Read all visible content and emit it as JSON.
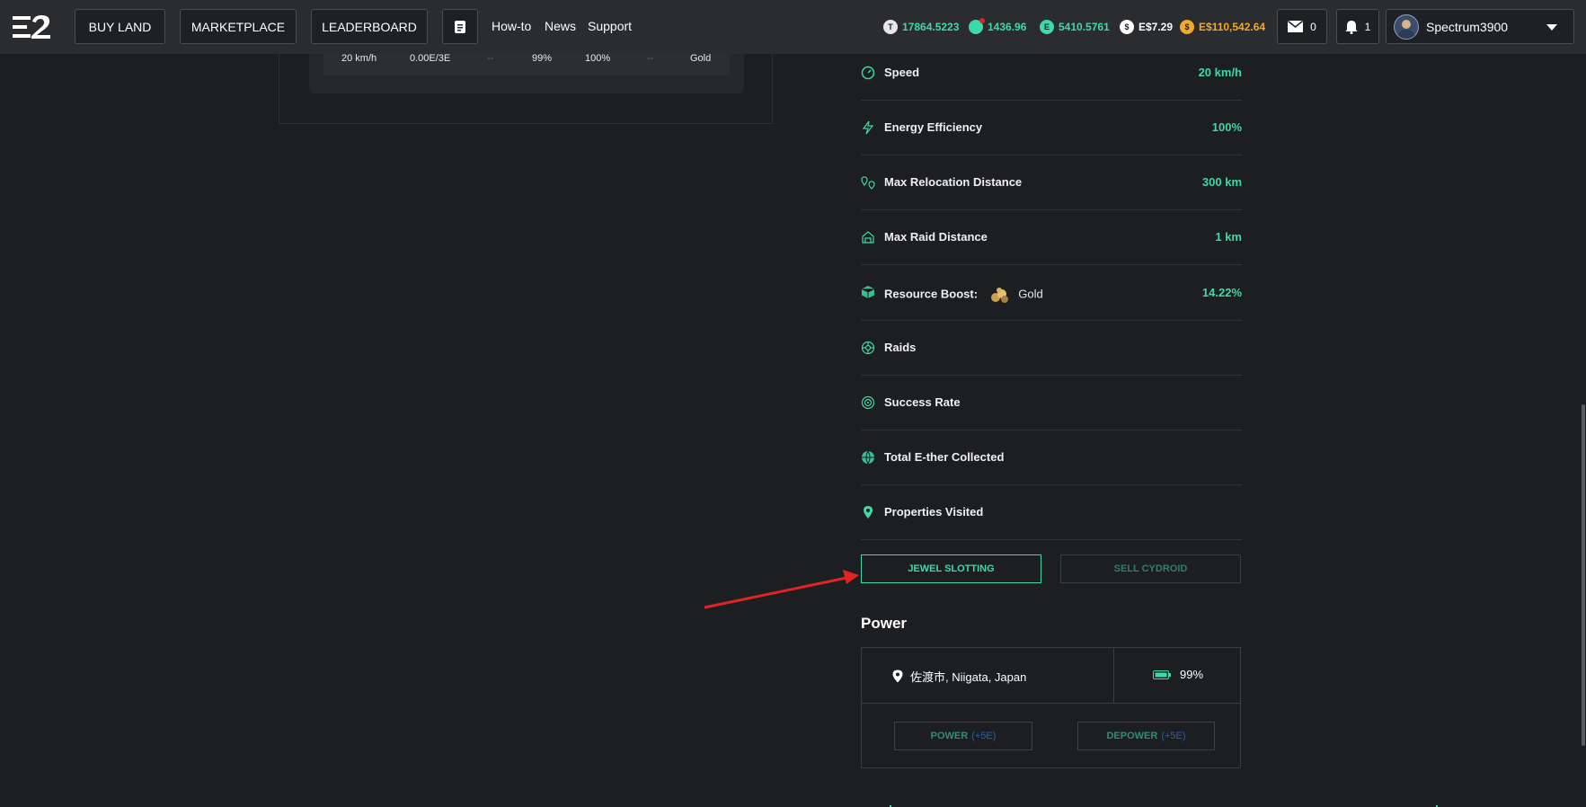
{
  "nav": {
    "buy_land": "BUY LAND",
    "marketplace": "MARKETPLACE",
    "leaderboard": "LEADERBOARD",
    "howto": "How-to",
    "news": "News",
    "support": "Support"
  },
  "balances": [
    {
      "icon": "tile-icon",
      "value": "17864.5223",
      "color": "#3dd9a8"
    },
    {
      "icon": "essence-icon",
      "value": "1436.96",
      "color": "#3dd9a8"
    },
    {
      "icon": "ether-icon",
      "value": "5410.5761",
      "color": "#3dd9a8"
    },
    {
      "icon": "dollar-icon",
      "value": "E$7.29",
      "color": "#ffffff"
    },
    {
      "icon": "gold-coin-icon",
      "value": "E$110,542.64",
      "color": "#f0a928"
    }
  ],
  "mail_count": "0",
  "notif_count": "1",
  "username": "Spectrum3900",
  "left_table_row": [
    "20 km/h",
    "0.00E/3E",
    "--",
    "99%",
    "100%",
    "--",
    "Gold"
  ],
  "stats": [
    {
      "icon": "speed-icon",
      "label": "Speed",
      "value": "20 km/h"
    },
    {
      "icon": "energy-icon",
      "label": "Energy Efficiency",
      "value": "100%"
    },
    {
      "icon": "relocation-icon",
      "label": "Max Relocation Distance",
      "value": "300 km"
    },
    {
      "icon": "raid-distance-icon",
      "label": "Max Raid Distance",
      "value": "1 km"
    },
    {
      "icon": "resource-boost-icon",
      "label": "Resource Boost:",
      "resource": "Gold",
      "value": "14.22%"
    },
    {
      "icon": "raids-icon",
      "label": "Raids",
      "value": ""
    },
    {
      "icon": "success-rate-icon",
      "label": "Success Rate",
      "value": ""
    },
    {
      "icon": "ether-collected-icon",
      "label": "Total E-ther Collected",
      "value": ""
    },
    {
      "icon": "location-pin-icon",
      "label": "Properties Visited",
      "value": ""
    }
  ],
  "actions": {
    "jewel": "JEWEL SLOTTING",
    "sell": "SELL CYDROID"
  },
  "power": {
    "title": "Power",
    "location": "佐渡市, Niigata, Japan",
    "battery": "99%",
    "power_btn": "POWER",
    "power_cost": "(+5E)",
    "depower_btn": "DEPOWER",
    "depower_cost": "(+5E)"
  },
  "colors": {
    "accent": "#3dd9a8",
    "arrow": "#e02424",
    "gold": "#f0a928"
  }
}
